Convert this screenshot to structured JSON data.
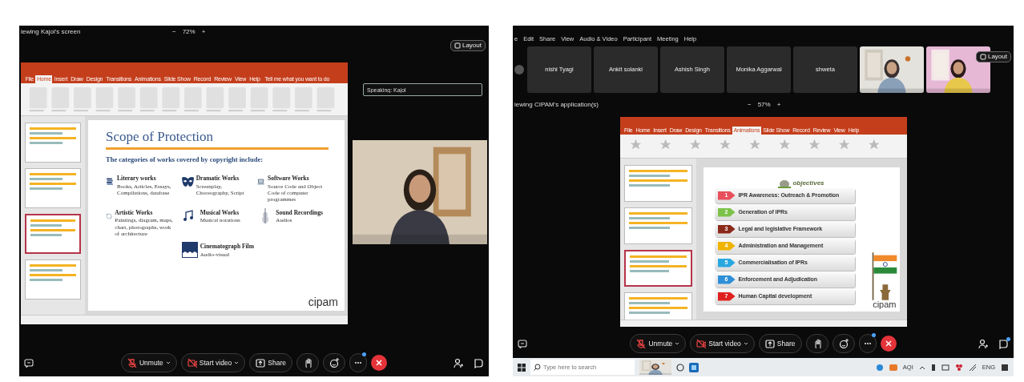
{
  "left_meeting": {
    "viewing_label": "iewing Kajol's screen",
    "zoom": {
      "minus": "−",
      "level": "72%",
      "plus": "+"
    },
    "layout_button": "Layout",
    "presentation": {
      "tabs": [
        {
          "label": "File",
          "selected": false
        },
        {
          "label": "Home",
          "selected": true
        },
        {
          "label": "Insert",
          "selected": false
        },
        {
          "label": "Draw",
          "selected": false
        },
        {
          "label": "Design",
          "selected": false
        },
        {
          "label": "Transitions",
          "selected": false
        },
        {
          "label": "Animations",
          "selected": false
        },
        {
          "label": "Slide Show",
          "selected": false
        },
        {
          "label": "Record",
          "selected": false
        },
        {
          "label": "Review",
          "selected": false
        },
        {
          "label": "View",
          "selected": false
        },
        {
          "label": "Help",
          "selected": false
        }
      ],
      "tell_me": "Tell me what you want to do",
      "thumbnails": [
        {
          "selected": false
        },
        {
          "selected": false
        },
        {
          "selected": true
        },
        {
          "selected": false
        }
      ],
      "slide": {
        "kind": "works",
        "title": "Scope of Protection",
        "subtitle": "The categories of works covered by copyright include:",
        "works": [
          {
            "kind": "books",
            "title": "Literary works",
            "description": "Books, Articles, Essays, Compilations, database"
          },
          {
            "kind": "mask",
            "title": "Dramatic Works",
            "description": "Screenplay, Choreography, Script"
          },
          {
            "kind": "computer",
            "title": "Software Works",
            "description": "Source Code and Object Code of computer programmes"
          },
          {
            "kind": "art",
            "title": "Artistic Works",
            "description": "Paintings, diagram, maps, chart, photographs, work of architecture"
          },
          {
            "kind": "music",
            "title": "Musical Works",
            "description": "Musical notations"
          },
          {
            "kind": "violin",
            "title": "Sound Recordings",
            "description": "Audios"
          },
          {
            "kind": "film",
            "title": "Cinematograph Film",
            "description": "Audio-visual"
          }
        ],
        "logo": "cipam"
      }
    },
    "speaking_field": {
      "value": "Speaking: Kajol"
    },
    "toolbar": {
      "controls": [
        {
          "kind": "mute",
          "label": "Unmute",
          "caret": true
        },
        {
          "kind": "video",
          "label": "Start video",
          "caret": true
        },
        {
          "kind": "share",
          "label": "Share",
          "caret": false
        },
        {
          "kind": "hand"
        },
        {
          "kind": "reaction"
        },
        {
          "kind": "more",
          "notification": true
        },
        {
          "kind": "end"
        }
      ],
      "side": [
        {
          "kind": "participants",
          "notification": false
        },
        {
          "kind": "chat",
          "notification": false
        }
      ]
    }
  },
  "right_meeting": {
    "menu": [
      "e",
      "Edit",
      "Share",
      "View",
      "Audio & Video",
      "Participant",
      "Meeting",
      "Help"
    ],
    "participants": [
      {
        "kind": "name",
        "name": "nishi Tyagi"
      },
      {
        "kind": "name",
        "name": "Ankit solanki"
      },
      {
        "kind": "name",
        "name": "Ashish Singh"
      },
      {
        "kind": "name",
        "name": "Monika Aggarwal"
      },
      {
        "kind": "name",
        "name": "shweta"
      },
      {
        "kind": "video"
      },
      {
        "kind": "video"
      }
    ],
    "layout_button": "Layout",
    "viewing_label": "iewing CIPAM's application(s)",
    "zoom": {
      "minus": "−",
      "level": "57%",
      "plus": "+"
    },
    "presentation": {
      "tabs": [
        {
          "label": "File",
          "selected": false
        },
        {
          "label": "Home",
          "selected": false
        },
        {
          "label": "Insert",
          "selected": false
        },
        {
          "label": "Draw",
          "selected": false
        },
        {
          "label": "Design",
          "selected": false
        },
        {
          "label": "Transitions",
          "selected": false
        },
        {
          "label": "Animations",
          "selected": true
        },
        {
          "label": "Slide Show",
          "selected": false
        },
        {
          "label": "Record",
          "selected": false
        },
        {
          "label": "Review",
          "selected": false
        },
        {
          "label": "View",
          "selected": false
        },
        {
          "label": "Help",
          "selected": false
        }
      ],
      "thumbnails": [
        {
          "selected": false
        },
        {
          "selected": false
        },
        {
          "selected": true
        },
        {
          "selected": false
        }
      ],
      "slide": {
        "kind": "objectives",
        "heading": "objectives",
        "objectives": [
          {
            "number": "1",
            "color": "#e8505b",
            "label": "IPR Awareness: Outreach & Promotion"
          },
          {
            "number": "2",
            "color": "#7cc24a",
            "label": "Generation of IPRs"
          },
          {
            "number": "3",
            "color": "#8b2a1a",
            "label": "Legal and legislative Framework"
          },
          {
            "number": "4",
            "color": "#f0b400",
            "label": "Administration and Management"
          },
          {
            "number": "5",
            "color": "#29a8e0",
            "label": "Commercialisation of IPRs"
          },
          {
            "number": "6",
            "color": "#2f8fd8",
            "label": "Enforcement and Adjudication"
          },
          {
            "number": "7",
            "color": "#e02020",
            "label": "Human Capital development"
          }
        ],
        "logo": "cipam"
      }
    },
    "toolbar": {
      "controls": [
        {
          "kind": "mute",
          "label": "Unmute",
          "caret": true
        },
        {
          "kind": "video",
          "label": "Start video",
          "caret": true
        },
        {
          "kind": "share",
          "label": "Share",
          "caret": false
        },
        {
          "kind": "hand"
        },
        {
          "kind": "reaction"
        },
        {
          "kind": "more",
          "notification": true
        },
        {
          "kind": "end"
        }
      ],
      "side": [
        {
          "kind": "participants",
          "notification": false
        },
        {
          "kind": "chat",
          "notification": true
        }
      ]
    },
    "taskbar": {
      "search_placeholder": "Type here to search",
      "weather": "AQI",
      "language": "ENG"
    }
  }
}
